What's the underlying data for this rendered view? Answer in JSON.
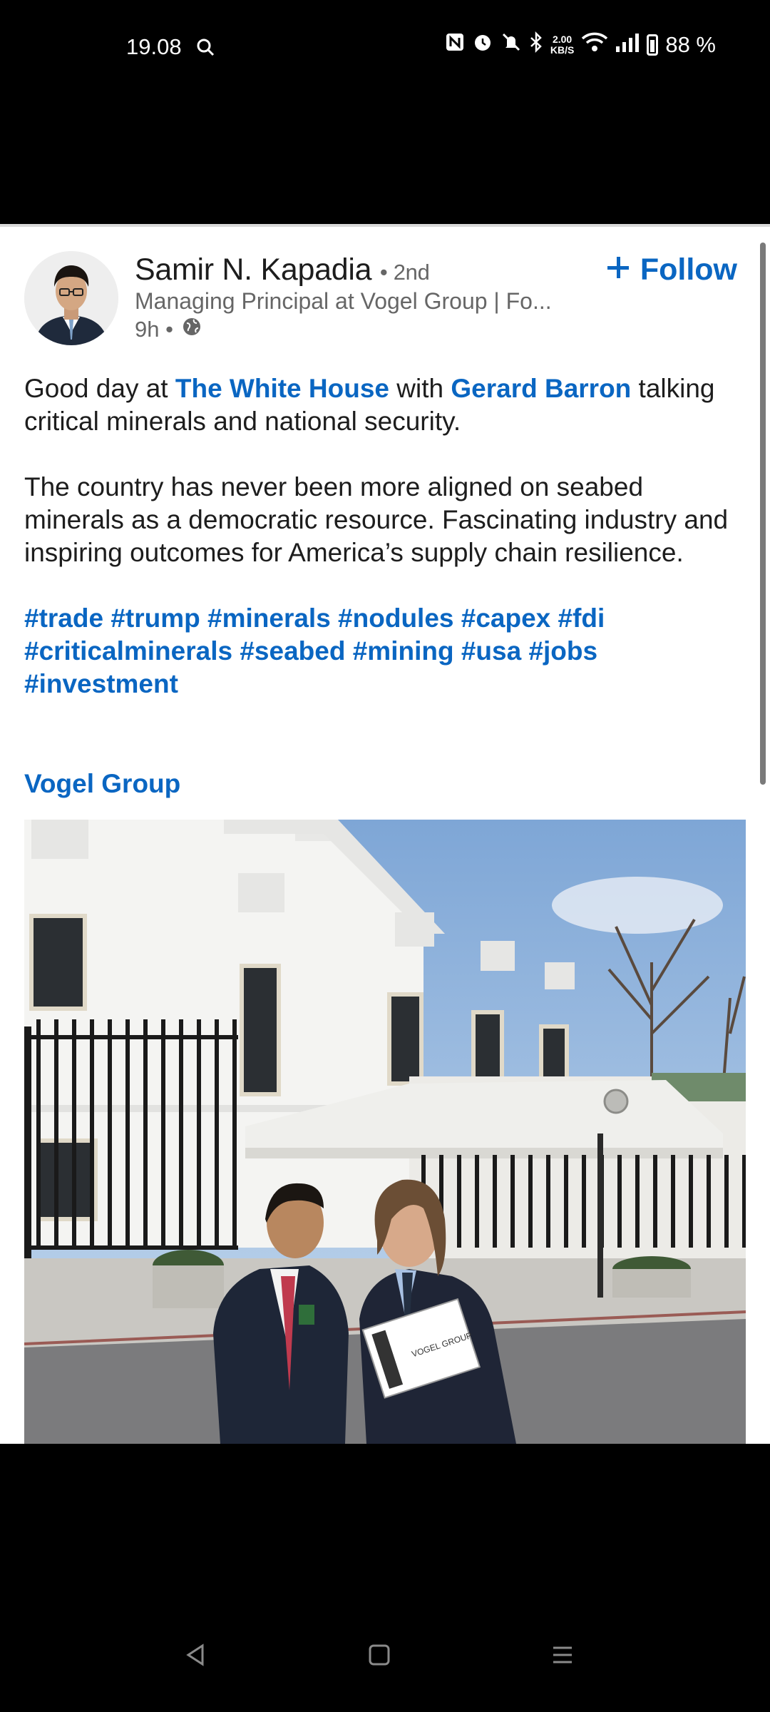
{
  "status_bar": {
    "time": "19.08",
    "net_speed_value": "2.00",
    "net_speed_unit": "KB/S",
    "battery": "88 %",
    "icons": [
      "search-icon",
      "nfc-icon",
      "alarm-icon",
      "mute-icon",
      "bluetooth-icon",
      "wifi-icon",
      "signal-icon",
      "battery-icon"
    ]
  },
  "post": {
    "author": {
      "name": "Samir N. Kapadia",
      "degree": "• 2nd",
      "headline": "Managing Principal at Vogel Group | Fo...",
      "time": "9h •"
    },
    "follow_label": "Follow",
    "body": {
      "p1_a": "Good day at ",
      "p1_link1": "The White House",
      "p1_b": " with ",
      "p1_link2": "Gerard Barron",
      "p1_c": " talking critical minerals and national security.",
      "p2": "The country has never been more aligned on seabed minerals as a democratic resource. Fascinating industry and inspiring outcomes for America’s supply chain resilience.",
      "hashtags": "#trade #trump #minerals #nodules #capex #fdi #criticalminerals #seabed #mining #usa #jobs #investment"
    },
    "company_mention": "Vogel Group",
    "photo_folder_text": "VOGEL GROUP"
  },
  "colors": {
    "accent": "#0a66c2",
    "text": "#1d1d1d",
    "muted": "#666666"
  }
}
